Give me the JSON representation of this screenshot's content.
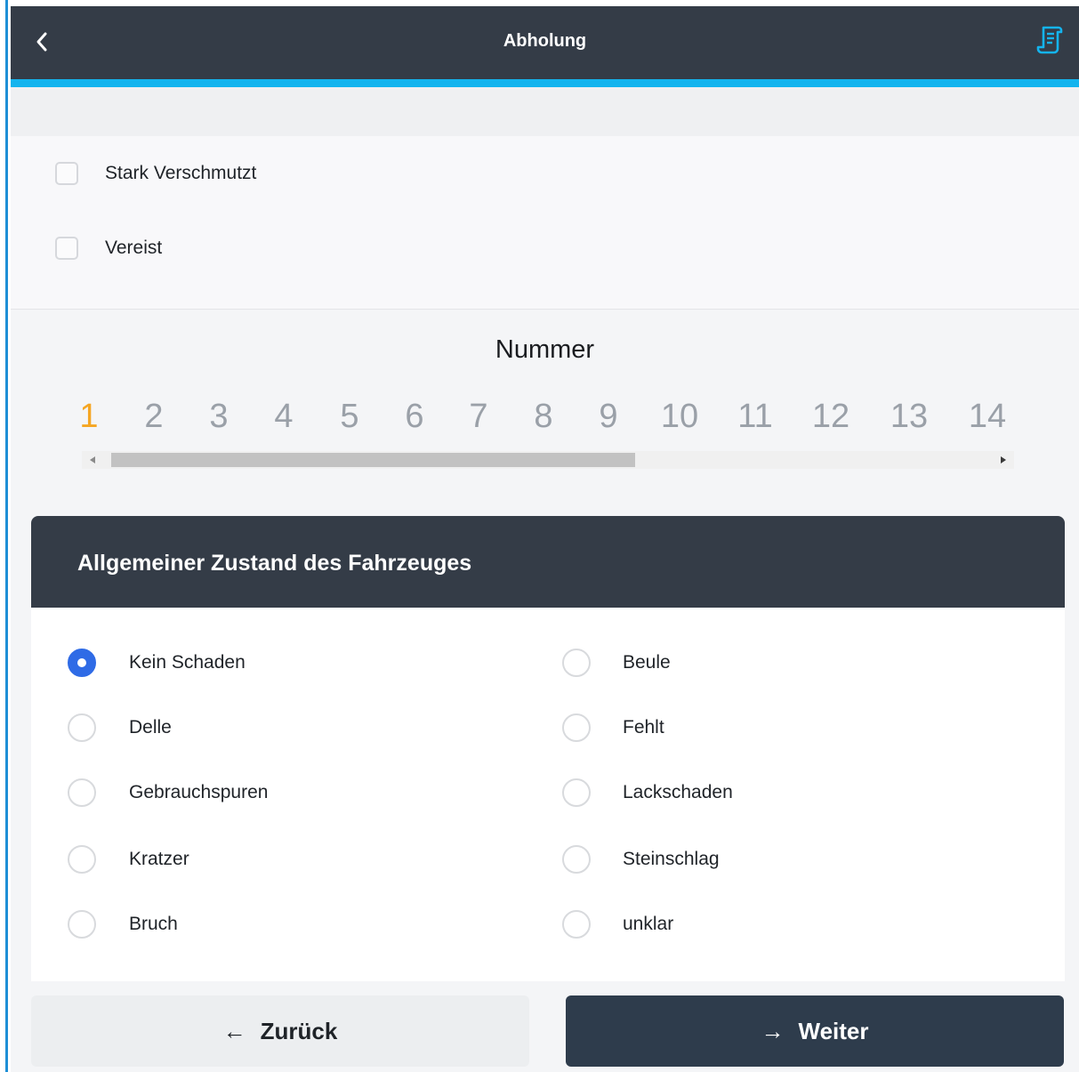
{
  "header": {
    "title": "Abholung",
    "back_icon": "chevron-left-icon",
    "doc_icon": "document-icon",
    "accent_color": "#14b4ee",
    "background_color": "#343c47"
  },
  "checkboxes": [
    {
      "label": "Stark Verschmutzt",
      "checked": false
    },
    {
      "label": "Vereist",
      "checked": false
    }
  ],
  "number_picker": {
    "title": "Nummer",
    "numbers": [
      "1",
      "2",
      "3",
      "4",
      "5",
      "6",
      "7",
      "8",
      "9",
      "10",
      "11",
      "12",
      "13",
      "14"
    ],
    "selected": "1",
    "selected_color": "#f5a623"
  },
  "condition_panel": {
    "title": "Allgemeiner Zustand des Fahrzeuges",
    "selected": "Kein Schaden",
    "options_left": [
      "Kein Schaden",
      "Delle",
      "Gebrauchspuren",
      "Kratzer",
      "Bruch"
    ],
    "options_right": [
      "Beule",
      "Fehlt",
      "Lackschaden",
      "Steinschlag",
      "unklar"
    ],
    "radio_checked_color": "#2f6be6"
  },
  "footer": {
    "back_label": "Zurück",
    "next_label": "Weiter",
    "back_icon": "arrow-left-icon",
    "next_icon": "arrow-right-icon"
  }
}
